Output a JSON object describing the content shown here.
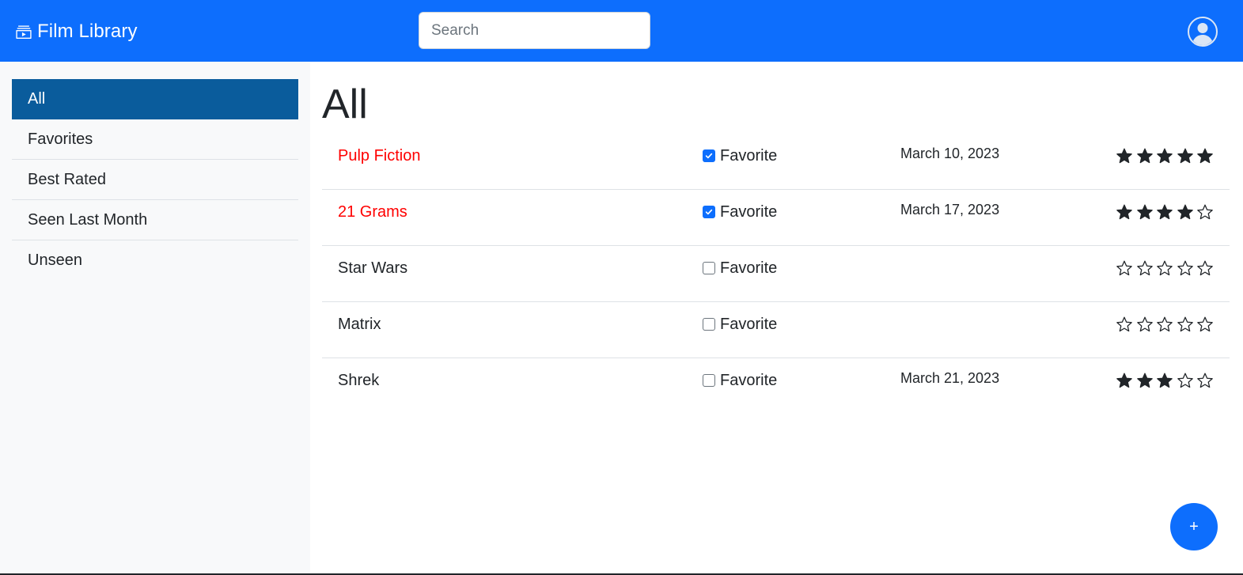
{
  "app": {
    "title": "Film Library",
    "brand_icon": "film-collection-icon"
  },
  "header": {
    "search_placeholder": "Search",
    "search_value": "",
    "user_icon": "user-circle-icon",
    "background_color": "#0d6efd"
  },
  "sidebar": {
    "active_color": "#0a5c9c",
    "items": [
      {
        "label": "All",
        "active": true
      },
      {
        "label": "Favorites",
        "active": false
      },
      {
        "label": "Best Rated",
        "active": false
      },
      {
        "label": "Seen Last Month",
        "active": false
      },
      {
        "label": "Unseen",
        "active": false
      }
    ]
  },
  "main": {
    "title": "All",
    "favorite_title_color": "#ff0000",
    "films": [
      {
        "title": "Pulp Fiction",
        "favorite": true,
        "favorite_label": "Favorite",
        "date": "March 10, 2023",
        "rating": 5
      },
      {
        "title": "21 Grams",
        "favorite": true,
        "favorite_label": "Favorite",
        "date": "March 17, 2023",
        "rating": 4
      },
      {
        "title": "Star Wars",
        "favorite": false,
        "favorite_label": "Favorite",
        "date": "",
        "rating": 0
      },
      {
        "title": "Matrix",
        "favorite": false,
        "favorite_label": "Favorite",
        "date": "",
        "rating": 0
      },
      {
        "title": "Shrek",
        "favorite": false,
        "favorite_label": "Favorite",
        "date": "March 21, 2023",
        "rating": 3
      }
    ],
    "max_rating": 5
  },
  "add_button": {
    "label": "+"
  }
}
